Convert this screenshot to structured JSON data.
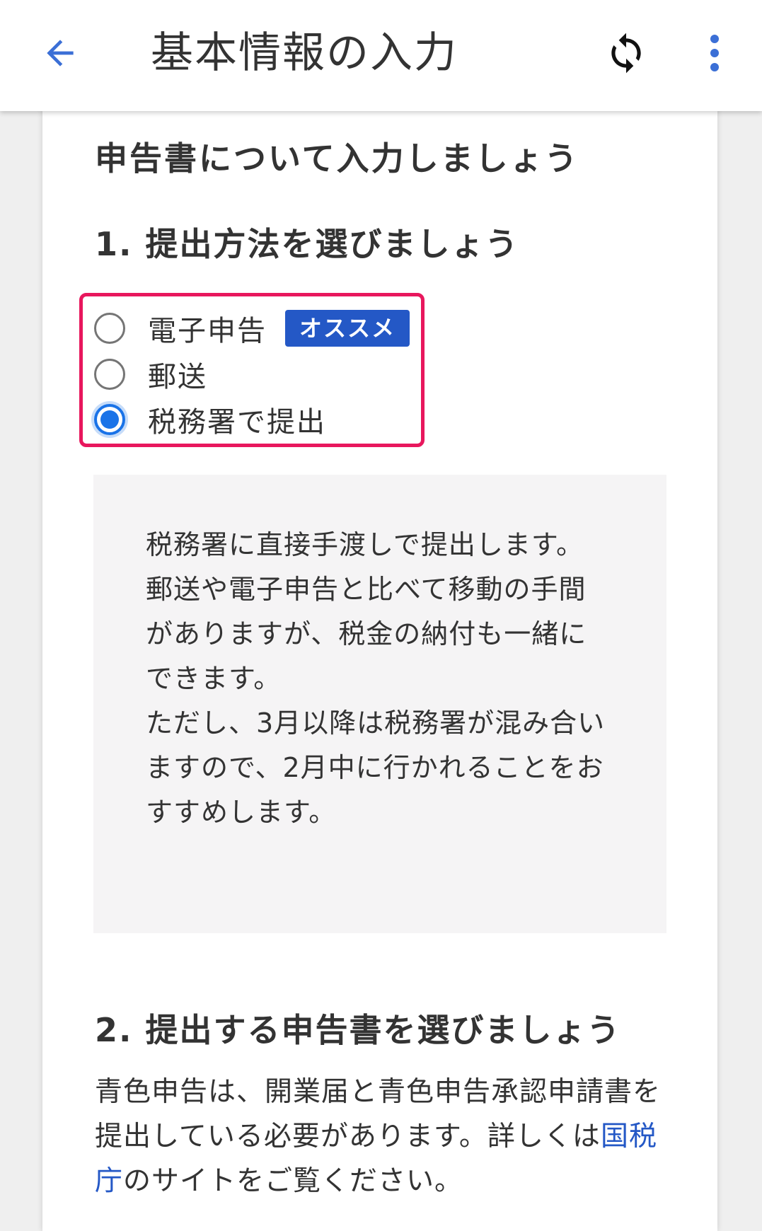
{
  "app_bar": {
    "title": "基本情報の入力",
    "back_icon": "arrow-left-icon",
    "sync_icon": "sync-icon",
    "more_icon": "more-vert-icon",
    "accent_color": "#3b6fd6"
  },
  "page": {
    "heading": "申告書について入力しましょう"
  },
  "section1": {
    "title": "1. 提出方法を選びましょう",
    "options": [
      {
        "label": "電子申告",
        "badge": "オススメ",
        "selected": false
      },
      {
        "label": "郵送",
        "selected": false
      },
      {
        "label": "税務署で提出",
        "selected": true
      }
    ],
    "description": [
      "税務署に直接手渡しで提出します。",
      "郵送や電子申告と比べて移動の手間がありますが、税金の納付も一緒にできます。",
      "ただし、3月以降は税務署が混み合いますので、2月中に行かれることをおすすめします。"
    ]
  },
  "section2": {
    "title": "2. 提出する申告書を選びましょう",
    "text_before_link": "青色申告は、開業届と青色申告承認申請書を提出している必要があります。詳しくは",
    "link_text": "国税庁",
    "text_after_link": "のサイトをご覧ください。"
  },
  "colors": {
    "highlight_border": "#e8175d",
    "radio_selected": "#1a73e8",
    "badge_bg": "#2458c6",
    "info_bg": "#f5f4f5"
  }
}
